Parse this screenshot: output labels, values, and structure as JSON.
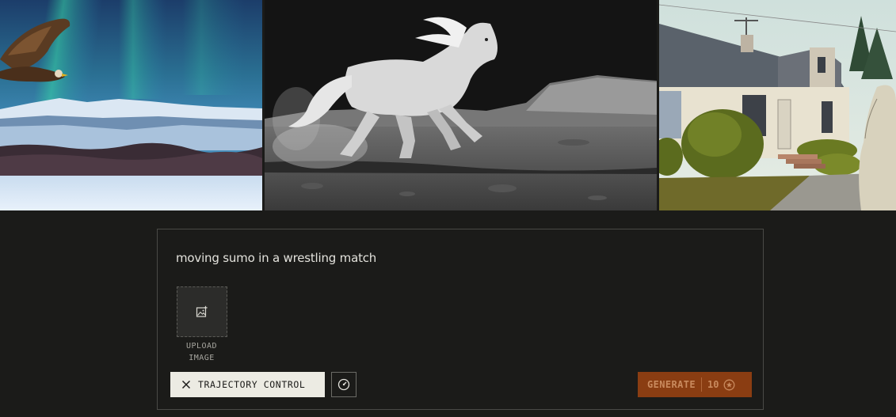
{
  "gallery": {
    "items": [
      {
        "name": "eagle-aurora-image"
      },
      {
        "name": "white-horse-moon-image"
      },
      {
        "name": "suburban-house-image"
      }
    ]
  },
  "composer": {
    "prompt_text": "moving sumo in a wrestling match",
    "upload": {
      "line1": "UPLOAD",
      "line2": "IMAGE",
      "icon": "image-add-icon"
    },
    "trajectory_control": {
      "label": "TRAJECTORY CONTROL",
      "icon": "close-icon"
    },
    "motion_button": {
      "icon": "gauge-icon"
    },
    "generate": {
      "label": "GENERATE",
      "cost": "10",
      "icon": "coin-icon"
    }
  },
  "colors": {
    "background": "#1b1b19",
    "chip_bg": "#ecebe3",
    "generate_bg": "#8a3d12",
    "generate_text": "#c98a5e"
  }
}
